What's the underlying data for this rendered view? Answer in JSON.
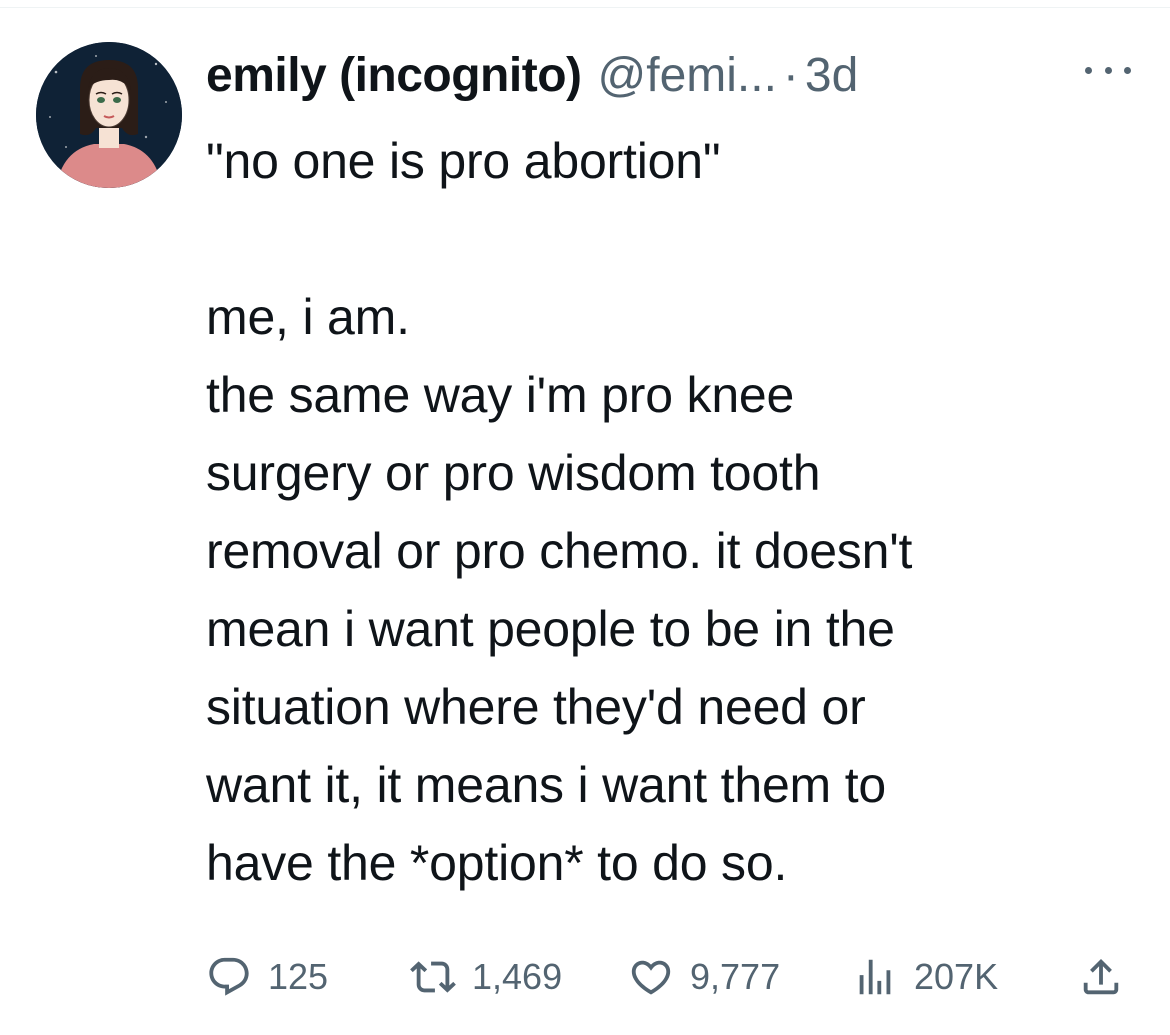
{
  "tweet": {
    "author": {
      "display_name": "emily (incognito)",
      "handle": "@femi...",
      "separator": "·",
      "time": "3d"
    },
    "text": "\"no one is pro abortion\"\n\nme, i am.\nthe same way i'm pro knee\nsurgery or pro wisdom tooth\nremoval or pro chemo. it doesn't\nmean i want people to be in the\nsituation where they'd need or\nwant it, it means i want them to\nhave the *option* to do so.",
    "stats": {
      "replies": "125",
      "retweets": "1,469",
      "likes": "9,777",
      "views": "207K"
    }
  },
  "icons": {
    "more": "more-icon",
    "reply": "reply-icon",
    "retweet": "retweet-icon",
    "like": "heart-icon",
    "views": "views-icon",
    "share": "share-icon"
  },
  "colors": {
    "text": "#0f1419",
    "secondary": "#536471",
    "avatar_bg": "#0f2236",
    "avatar_shirt": "#dc8a8a"
  }
}
